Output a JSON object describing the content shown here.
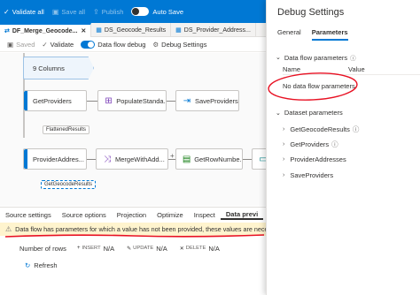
{
  "top_toolbar": {
    "validate_all": "Validate all",
    "save_all": "Save all",
    "publish": "Publish",
    "auto_save": "Auto Save"
  },
  "tabs": [
    {
      "label": "DF_Merge_Geocode..."
    },
    {
      "label": "DS_Geocode_Results"
    },
    {
      "label": "DS_Provider_Address..."
    }
  ],
  "df_toolbar": {
    "saved": "Saved",
    "validate": "Validate",
    "debug": "Data flow debug",
    "debug_settings": "Debug Settings"
  },
  "canvas": {
    "columns_node": "9 Columns",
    "row1": [
      "GetProviders",
      "PopulateStanda...",
      "SaveProviders"
    ],
    "row1_chip": "FlattenedResults",
    "row2": [
      "ProviderAddres...",
      "MergeWithAdd...",
      "GetRowNumbe..."
    ],
    "row2_chip": "GetGeocodeResults"
  },
  "bottom_tabs": [
    "Source settings",
    "Source options",
    "Projection",
    "Optimize",
    "Inspect",
    "Data previ"
  ],
  "warning": "Data flow has parameters for which a value has not been provided, these values are nece",
  "stats": {
    "rows_label": "Number of rows",
    "insert_label": "INSERT",
    "insert_value": "N/A",
    "update_label": "UPDATE",
    "update_value": "N/A",
    "delete_label": "DELETE",
    "delete_value": "N/A"
  },
  "refresh": "Refresh",
  "panel": {
    "title": "Debug Settings",
    "tabs": [
      "General",
      "Parameters"
    ],
    "dataflow_section": "Data flow parameters",
    "col_name": "Name",
    "col_value": "Value",
    "empty": "No data flow parameters",
    "dataset_section": "Dataset parameters",
    "datasets": [
      "GetGeocodeResults",
      "GetProviders",
      "ProviderAddresses",
      "SaveProviders"
    ]
  },
  "colors": {
    "accent": "#0078d4",
    "annotation": "#e81123"
  }
}
